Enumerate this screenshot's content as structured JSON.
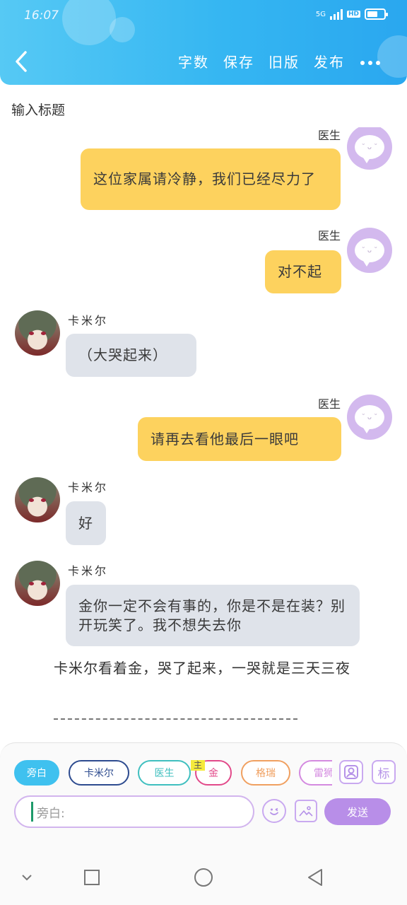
{
  "status": {
    "time": "16:07",
    "network": "5G",
    "hd": "HD"
  },
  "header": {
    "back_icon": "chevron-left-icon",
    "menu": [
      "字数",
      "保存",
      "旧版",
      "发布"
    ],
    "more_icon": "more-dots-icon"
  },
  "title_placeholder": "输入标题",
  "messages": [
    {
      "side": "right",
      "name": "医生",
      "text": "这位家属请冷静，我们已经尽力了"
    },
    {
      "side": "right",
      "name": "医生",
      "text": "对不起"
    },
    {
      "side": "left",
      "name": "卡米尔",
      "text": "（大哭起来）"
    },
    {
      "side": "right",
      "name": "医生",
      "text": "请再去看他最后一眼吧"
    },
    {
      "side": "left",
      "name": "卡米尔",
      "text": "好"
    },
    {
      "side": "left",
      "name": "卡米尔",
      "text": "金你一定不会有事的，你是不是在装？别开玩笑了。我不想失去你"
    }
  ],
  "narration": "卡米尔看着金，哭了起来，一哭就是三天三夜",
  "divider": "-------------------------------------------",
  "roles": [
    {
      "label": "旁白",
      "color": "#3fc1ef",
      "active": true
    },
    {
      "label": "卡米尔",
      "color": "#2d4b8f",
      "active": false
    },
    {
      "label": "医生",
      "color": "#3fbfbf",
      "active": false
    },
    {
      "label": "金",
      "color": "#e24a8a",
      "active": false,
      "badge": "主"
    },
    {
      "label": "格瑞",
      "color": "#f0a060",
      "active": false
    },
    {
      "label": "雷狮",
      "color": "#d48ae0",
      "active": false
    }
  ],
  "panel": {
    "role_icon": "user-card-icon",
    "tag_label": "标",
    "input_placeholder": "旁白:",
    "emoji_icon": "emoji-icon",
    "image_icon": "image-icon",
    "send_label": "发送"
  },
  "sysnav": {
    "down_icon": "chevron-down-icon",
    "recent_icon": "square-icon",
    "home_icon": "circle-icon",
    "back_icon": "triangle-back-icon"
  }
}
